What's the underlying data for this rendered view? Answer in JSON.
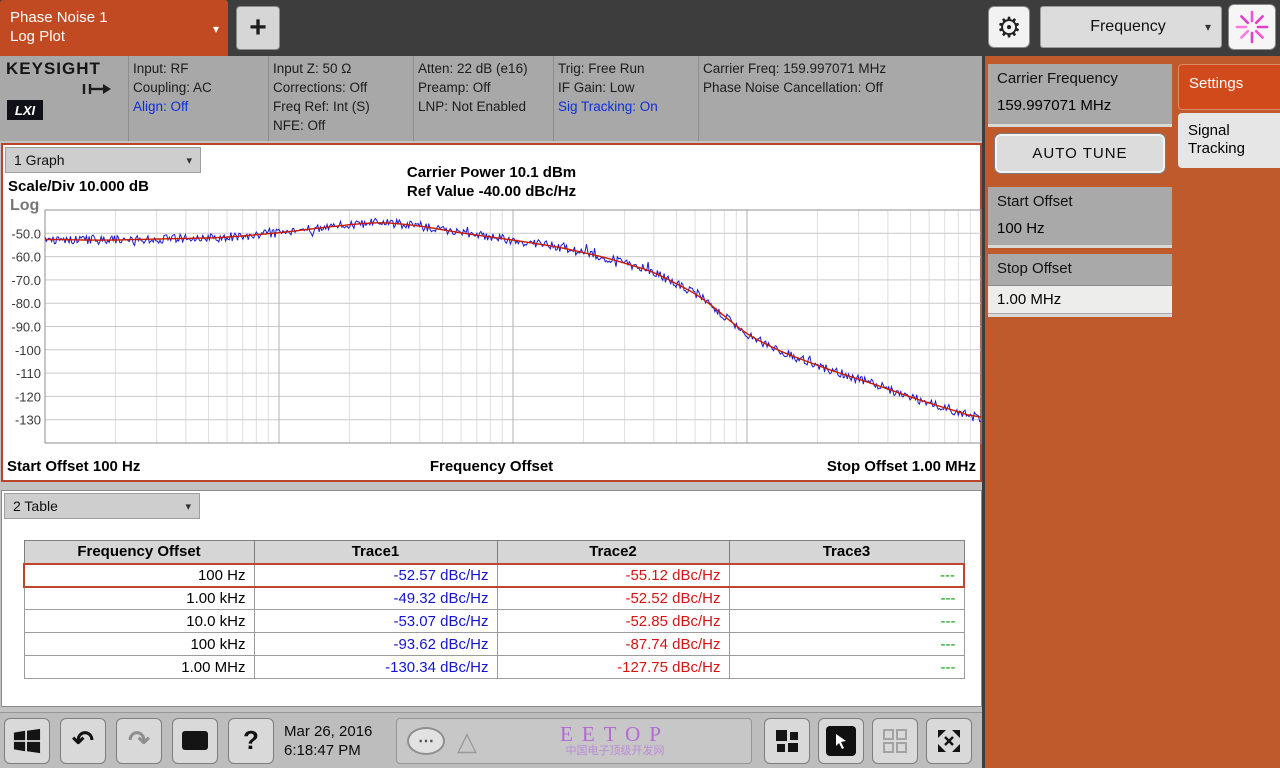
{
  "top_bar": {
    "measurement_tab": {
      "line1": "Phase Noise 1",
      "line2": "Log Plot"
    },
    "add_tab_label": "+",
    "mode_dropdown": {
      "label": "Frequency"
    }
  },
  "icons": {
    "caret": "▾",
    "gear": "⚙",
    "undo": "↶",
    "redo": "↷",
    "help": "?",
    "ellipsis": "⋯",
    "triangle": "△"
  },
  "status_bar": {
    "brand": "KEYSIGHT",
    "lxi_badge": "LXI",
    "col1": {
      "l1": "Input: RF",
      "l2": "Coupling: AC",
      "l3": "Align: Off"
    },
    "col2": {
      "l1": "Input Z: 50 Ω",
      "l2": "Corrections: Off",
      "l3": "Freq Ref: Int (S)",
      "l4": "NFE: Off"
    },
    "col3": {
      "l1": "Atten: 22 dB (e16)",
      "l2": "Preamp: Off",
      "l3": "LNP: Not Enabled"
    },
    "col4": {
      "l1": "Trig: Free Run",
      "l2": "IF Gain: Low",
      "l3": "Sig Tracking: On"
    },
    "col5": {
      "l1": "Carrier Freq: 159.997071 MHz",
      "l2": "Phase Noise Cancellation: Off"
    }
  },
  "graph_window": {
    "selector": "1 Graph",
    "scale_div": "Scale/Div 10.000 dB",
    "title1": "Carrier Power 10.1 dBm",
    "title2": "Ref Value -40.00 dBc/Hz",
    "y_axis_type": "Log",
    "start_label": "Start Offset 100 Hz",
    "x_label": "Frequency Offset",
    "stop_label": "Stop Offset 1.00 MHz"
  },
  "chart_data": {
    "type": "line",
    "title": "Carrier Power 10.1 dBm / Ref Value -40.00 dBc/Hz",
    "xlabel": "Frequency Offset",
    "ylabel": "dBc/Hz",
    "x_log_range": [
      2,
      6
    ],
    "x_start": "100 Hz",
    "x_stop": "1.00 MHz",
    "y_range": [
      -140,
      -40
    ],
    "ref_value": -40,
    "scale_per_div": 10,
    "y_tick_values": [
      -50,
      -60,
      -70,
      -80,
      -90,
      -100,
      -110,
      -120,
      -130
    ],
    "y_tick_labels": [
      "-50.0",
      "-60.0",
      "-70.0",
      "-80.0",
      "-90.0",
      "-100",
      "-110",
      "-120",
      "-130"
    ],
    "grid": true,
    "legend": false,
    "series": [
      {
        "name": "Trace2 smoothed",
        "color": "#cc1a00",
        "logx": [
          2.0,
          2.25,
          2.5,
          2.75,
          3.0,
          3.2,
          3.35,
          3.45,
          3.6,
          3.8,
          4.0,
          4.2,
          4.4,
          4.6,
          4.8,
          5.0,
          5.15,
          5.35,
          5.55,
          5.75,
          5.9,
          6.0
        ],
        "db": [
          -52.6,
          -53.0,
          -52.4,
          -51.9,
          -49.8,
          -47.4,
          -45.8,
          -45.3,
          -46.8,
          -50.2,
          -52.9,
          -56.0,
          -60.5,
          -66.5,
          -77.0,
          -93.5,
          -101.0,
          -108.5,
          -115.0,
          -122.0,
          -126.5,
          -129.8
        ]
      },
      {
        "name": "Trace1 raw",
        "color": "#1a1acc",
        "noise_amplitude_db": 1.9
      }
    ]
  },
  "table_window": {
    "selector": "2 Table",
    "columns": [
      "Frequency Offset",
      "Trace1",
      "Trace2",
      "Trace3"
    ],
    "rows": [
      {
        "offset": "100 Hz",
        "t1": "-52.57 dBc/Hz",
        "t2": "-55.12 dBc/Hz",
        "t3": "---"
      },
      {
        "offset": "1.00 kHz",
        "t1": "-49.32 dBc/Hz",
        "t2": "-52.52 dBc/Hz",
        "t3": "---"
      },
      {
        "offset": "10.0 kHz",
        "t1": "-53.07 dBc/Hz",
        "t2": "-52.85 dBc/Hz",
        "t3": "---"
      },
      {
        "offset": "100 kHz",
        "t1": "-93.62 dBc/Hz",
        "t2": "-87.74 dBc/Hz",
        "t3": "---"
      },
      {
        "offset": "1.00 MHz",
        "t1": "-130.34 dBc/Hz",
        "t2": "-127.75 dBc/Hz",
        "t3": "---"
      }
    ]
  },
  "right_panel": {
    "carrier_frequency": {
      "label": "Carrier Frequency",
      "value": "159.997071 MHz"
    },
    "auto_tune_label": "AUTO TUNE",
    "start_offset": {
      "label": "Start Offset",
      "value": "100 Hz"
    },
    "stop_offset": {
      "label": "Stop Offset",
      "value": "1.00 MHz"
    },
    "tabs": [
      {
        "label": "Settings"
      },
      {
        "label": "Signal Tracking"
      }
    ]
  },
  "bottom_bar": {
    "date": "Mar 26, 2016",
    "time": "6:18:47 PM",
    "watermark_title": "EETOP",
    "watermark_subtitle": "中国电子顶级开发网"
  },
  "colors": {
    "accent_orange": "#c14a22",
    "panel_orange": "#bf5a2c",
    "trace1_blue": "#1a1acc",
    "trace2_red": "#cc1a00",
    "trace3_green": "#0aa00a",
    "status_highlight_blue": "#0c2fd6"
  }
}
